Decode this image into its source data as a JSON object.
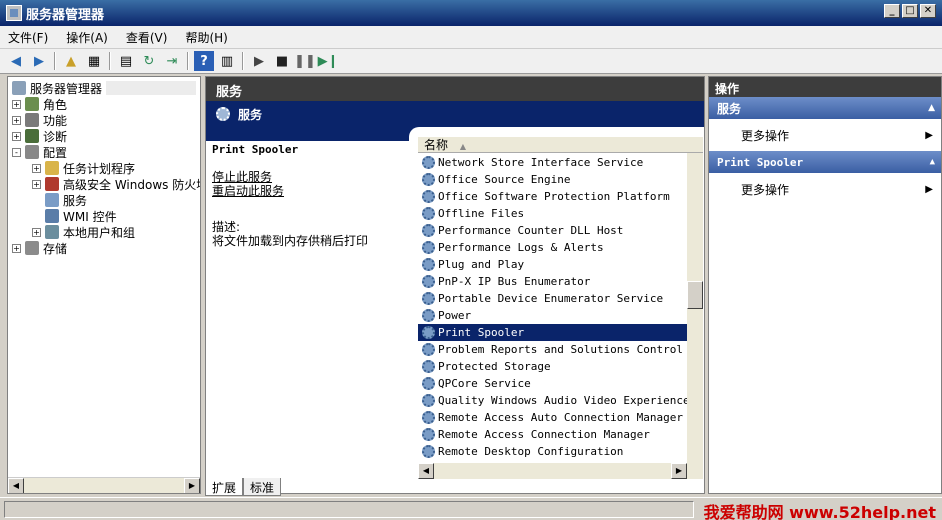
{
  "window": {
    "title": "服务器管理器",
    "buttons": [
      "_",
      "□",
      "✕"
    ]
  },
  "menu": [
    "文件(F)",
    "操作(A)",
    "查看(V)",
    "帮助(H)"
  ],
  "tree": {
    "root": "服务器管理器",
    "items": [
      {
        "label": "角色",
        "exp": "+",
        "icon": "roles-icon",
        "color": "#6b8e4e"
      },
      {
        "label": "功能",
        "exp": "+",
        "icon": "features-icon",
        "color": "#7a7a7a"
      },
      {
        "label": "诊断",
        "exp": "+",
        "icon": "diagnostics-icon",
        "color": "#4a6d3a"
      },
      {
        "label": "配置",
        "exp": "-",
        "icon": "configuration-icon",
        "color": "#888"
      },
      {
        "label": "任务计划程序",
        "exp": "+",
        "icon": "clock-icon",
        "color": "#d9b44a"
      },
      {
        "label": "高级安全 Windows 防火墙",
        "exp": "+",
        "icon": "firewall-icon",
        "color": "#b03a2e"
      },
      {
        "label": "服务",
        "exp": "",
        "icon": "gear-icon",
        "color": "#7a9cc6"
      },
      {
        "label": "WMI 控件",
        "exp": "",
        "icon": "wmi-icon",
        "color": "#5a7da8"
      },
      {
        "label": "本地用户和组",
        "exp": "+",
        "icon": "users-icon",
        "color": "#6b8e9e"
      },
      {
        "label": "存储",
        "exp": "+",
        "icon": "storage-icon",
        "color": "#8b8b8b"
      }
    ]
  },
  "middle": {
    "header": "服务",
    "subheader": "服务",
    "service_name": "Print Spooler",
    "stop_link": "停止此服务",
    "restart_link": "重启动此服务",
    "desc_label": "描述:",
    "desc_text": "将文件加载到内存供稍后打印",
    "column": "名称",
    "services": [
      "Network Store Interface Service",
      "Office  Source Engine",
      "Office Software Protection Platform",
      "Offline Files",
      "Performance Counter DLL Host",
      "Performance Logs & Alerts",
      "Plug and Play",
      "PnP-X IP Bus Enumerator",
      "Portable Device Enumerator Service",
      "Power",
      "Print Spooler",
      "Problem Reports and Solutions Control Pan",
      "Protected Storage",
      "QPCore Service",
      "Quality Windows Audio Video Experience",
      "Remote Access Auto Connection Manager",
      "Remote Access Connection Manager",
      "Remote Desktop Configuration"
    ],
    "selected_index": 10,
    "tabs": [
      "扩展",
      "标准"
    ]
  },
  "actions": {
    "header": "操作",
    "sections": [
      {
        "title": "服务",
        "more": "更多操作"
      },
      {
        "title": "Print Spooler",
        "more": "更多操作"
      }
    ]
  },
  "watermark": "我爱帮助网 www.52help.net"
}
